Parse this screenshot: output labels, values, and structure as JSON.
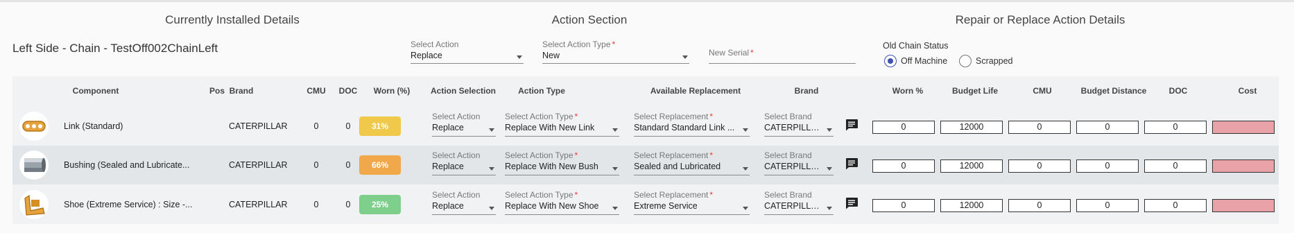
{
  "sections": {
    "installed": "Currently Installed Details",
    "action": "Action Section",
    "repair": "Repair or Replace Action Details"
  },
  "asset_title": "Left Side - Chain - TestOff002ChainLeft",
  "top_fields": {
    "select_action": {
      "label": "Select Action",
      "value": "Replace"
    },
    "select_action_type": {
      "label": "Select Action Type",
      "required": "*",
      "value": "New"
    },
    "new_serial": {
      "label": "New Serial",
      "required": "*",
      "value": ""
    }
  },
  "old_chain_status": {
    "label": "Old Chain Status",
    "options": [
      "Off Machine",
      "Scrapped"
    ],
    "selected": "Off Machine"
  },
  "columns": {
    "component": "Component",
    "pos": "Pos",
    "brand": "Brand",
    "cmu": "CMU",
    "doc": "DOC",
    "worn": "Worn (%)",
    "action_selection": "Action Selection",
    "action_type": "Action Type",
    "available_replacement": "Available Replacement",
    "brand2": "Brand",
    "worn_pct": "Worn %",
    "budget_life": "Budget Life",
    "cmu2": "CMU",
    "budget_distance": "Budget Distance",
    "doc2": "DOC",
    "cost": "Cost"
  },
  "row_field_labels": {
    "action": "Select Action",
    "action_type": "Select Action Type",
    "replacement": "Select Replacement",
    "brand": "Select Brand",
    "required": "*"
  },
  "rows": [
    {
      "component": "Link (Standard)",
      "pos": "",
      "brand": "CATERPILLAR",
      "cmu": "0",
      "doc": "0",
      "worn": "31%",
      "worn_color": "#f0c84a",
      "thumb_icon": "chain-link-icon",
      "action": "Replace",
      "action_type": "Replace With New Link",
      "replacement": "Standard Standard Link ...",
      "repl_brand": "CATERPILLAR",
      "worn_pct": "0",
      "budget_life": "12000",
      "cmu2": "0",
      "budget_distance": "0",
      "doc2": "0"
    },
    {
      "component": "Bushing (Sealed and Lubricate...",
      "pos": "",
      "brand": "CATERPILLAR",
      "cmu": "0",
      "doc": "0",
      "worn": "66%",
      "worn_color": "#f0a84a",
      "thumb_icon": "bushing-icon",
      "action": "Replace",
      "action_type": "Replace With New Bush",
      "replacement": "Sealed and Lubricated",
      "repl_brand": "CATERPILLAR",
      "worn_pct": "0",
      "budget_life": "12000",
      "cmu2": "0",
      "budget_distance": "0",
      "doc2": "0"
    },
    {
      "component": "Shoe (Extreme Service) : Size -...",
      "pos": "",
      "brand": "CATERPILLAR",
      "cmu": "0",
      "doc": "0",
      "worn": "25%",
      "worn_color": "#7fcf8c",
      "thumb_icon": "track-shoe-icon",
      "action": "Replace",
      "action_type": "Replace With New Shoe",
      "replacement": "Extreme Service",
      "repl_brand": "CATERPILLAR",
      "worn_pct": "0",
      "budget_life": "12000",
      "cmu2": "0",
      "budget_distance": "0",
      "doc2": "0"
    }
  ],
  "colors": {
    "accent": "#3f51b5",
    "required": "#e53935",
    "cost_invalid": "#e9a3a8"
  },
  "icons": {
    "comment": "comment-icon",
    "dropdown": "chevron-down-icon"
  }
}
